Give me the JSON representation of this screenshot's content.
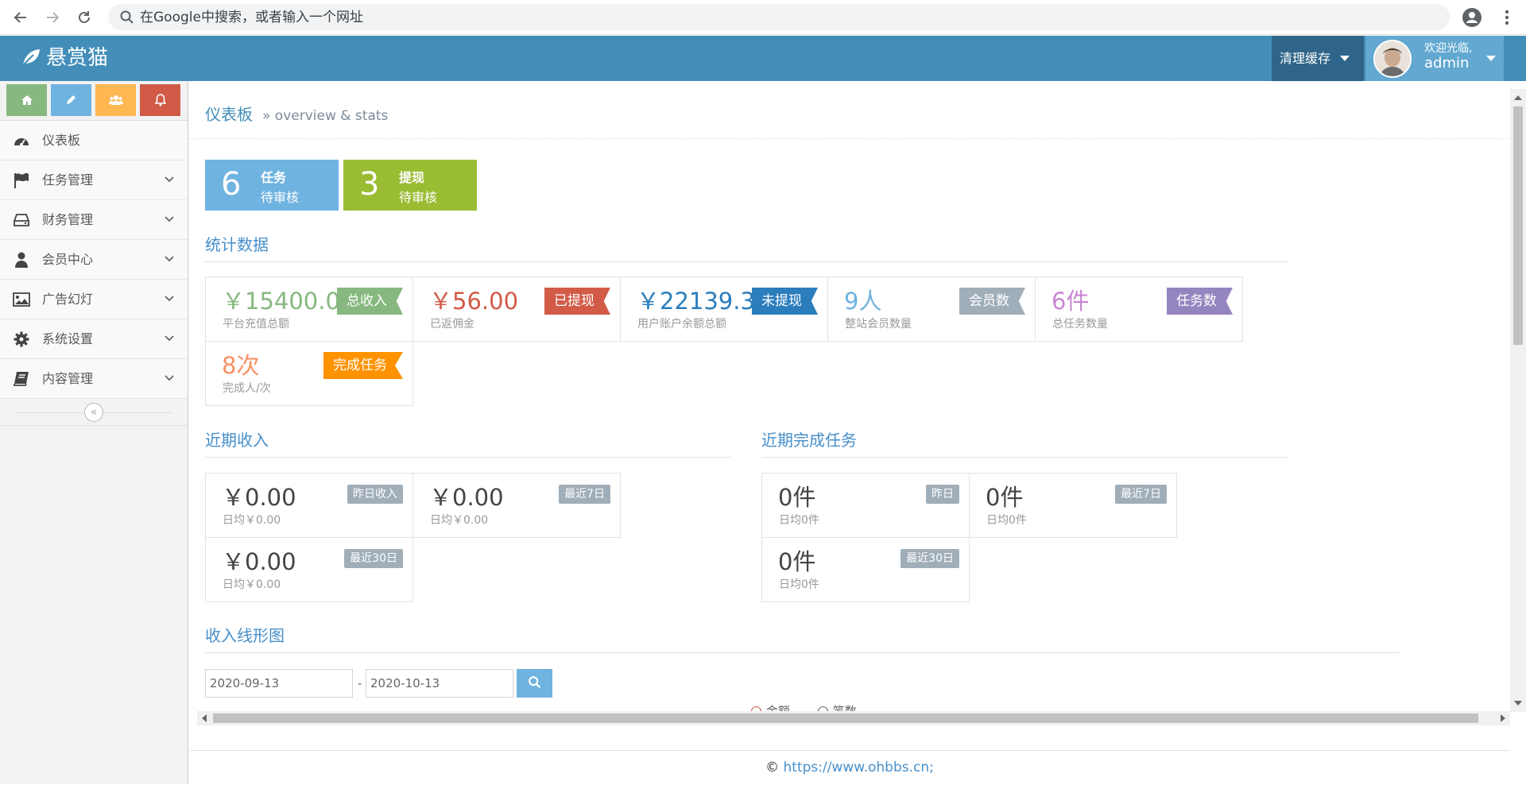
{
  "browser": {
    "omnibox_placeholder": "在Google中搜索，或者输入一个网址"
  },
  "header": {
    "brand": "悬赏猫",
    "clear_cache": "清理缓存",
    "welcome": "欢迎光临,",
    "username": "admin"
  },
  "sidebar": {
    "items": [
      {
        "label": "仪表板",
        "icon": "dashboard-icon"
      },
      {
        "label": "任务管理",
        "icon": "flag-icon"
      },
      {
        "label": "财务管理",
        "icon": "hdd-icon"
      },
      {
        "label": "会员中心",
        "icon": "user-icon"
      },
      {
        "label": "广告幻灯",
        "icon": "picture-icon"
      },
      {
        "label": "系统设置",
        "icon": "cog-icon"
      },
      {
        "label": "内容管理",
        "icon": "book-icon"
      }
    ],
    "collapse_glyph": "«"
  },
  "breadcrumb": {
    "title": "仪表板",
    "sub": "» overview & stats"
  },
  "pending": [
    {
      "num": "6",
      "line1": "任务",
      "line2": "待审核",
      "color": "#6fb3e0"
    },
    {
      "num": "3",
      "line1": "提现",
      "line2": "待审核",
      "color": "#9abc32"
    }
  ],
  "sections": {
    "stats": "统计数据",
    "recent_income": "近期收入",
    "recent_tasks": "近期完成任务",
    "chart": "收入线形图"
  },
  "stats": [
    {
      "value": "￥15400.00",
      "desc": "平台充值总额",
      "tag": "总收入",
      "tag_color": "#87b87f"
    },
    {
      "value": "￥56.00",
      "desc": "已返佣金",
      "tag": "已提现",
      "tag_color": "#d15b47"
    },
    {
      "value": "￥22139.34",
      "desc": "用户账户余额总额",
      "tag": "未提现",
      "tag_color": "#2b7dbc"
    },
    {
      "value": "9人",
      "desc": "整站会员数量",
      "tag": "会员数",
      "tag_color": "#a0aeb9"
    },
    {
      "value": "6件",
      "desc": "总任务数量",
      "tag": "任务数",
      "tag_color": "#9585bf"
    },
    {
      "value": "8次",
      "desc": "完成人/次",
      "tag": "完成任务",
      "tag_color": "#ff9200"
    }
  ],
  "income": [
    {
      "value": "￥0.00",
      "desc": "日均￥0.00",
      "badge": "昨日收入"
    },
    {
      "value": "￥0.00",
      "desc": "日均￥0.00",
      "badge": "最近7日"
    },
    {
      "value": "￥0.00",
      "desc": "日均￥0.00",
      "badge": "最近30日"
    }
  ],
  "tasks": [
    {
      "value": "0件",
      "desc": "日均0件",
      "badge": "昨日"
    },
    {
      "value": "0件",
      "desc": "日均0件",
      "badge": "最近7日"
    },
    {
      "value": "0件",
      "desc": "日均0件",
      "badge": "最近30日"
    }
  ],
  "chart_filter": {
    "start_date": "2020-09-13",
    "separator": "-",
    "end_date": "2020-10-13",
    "legend": [
      "金额",
      "笔数"
    ]
  },
  "footer": {
    "copyright": "©",
    "link": "https://www.ohbbs.cn;"
  }
}
